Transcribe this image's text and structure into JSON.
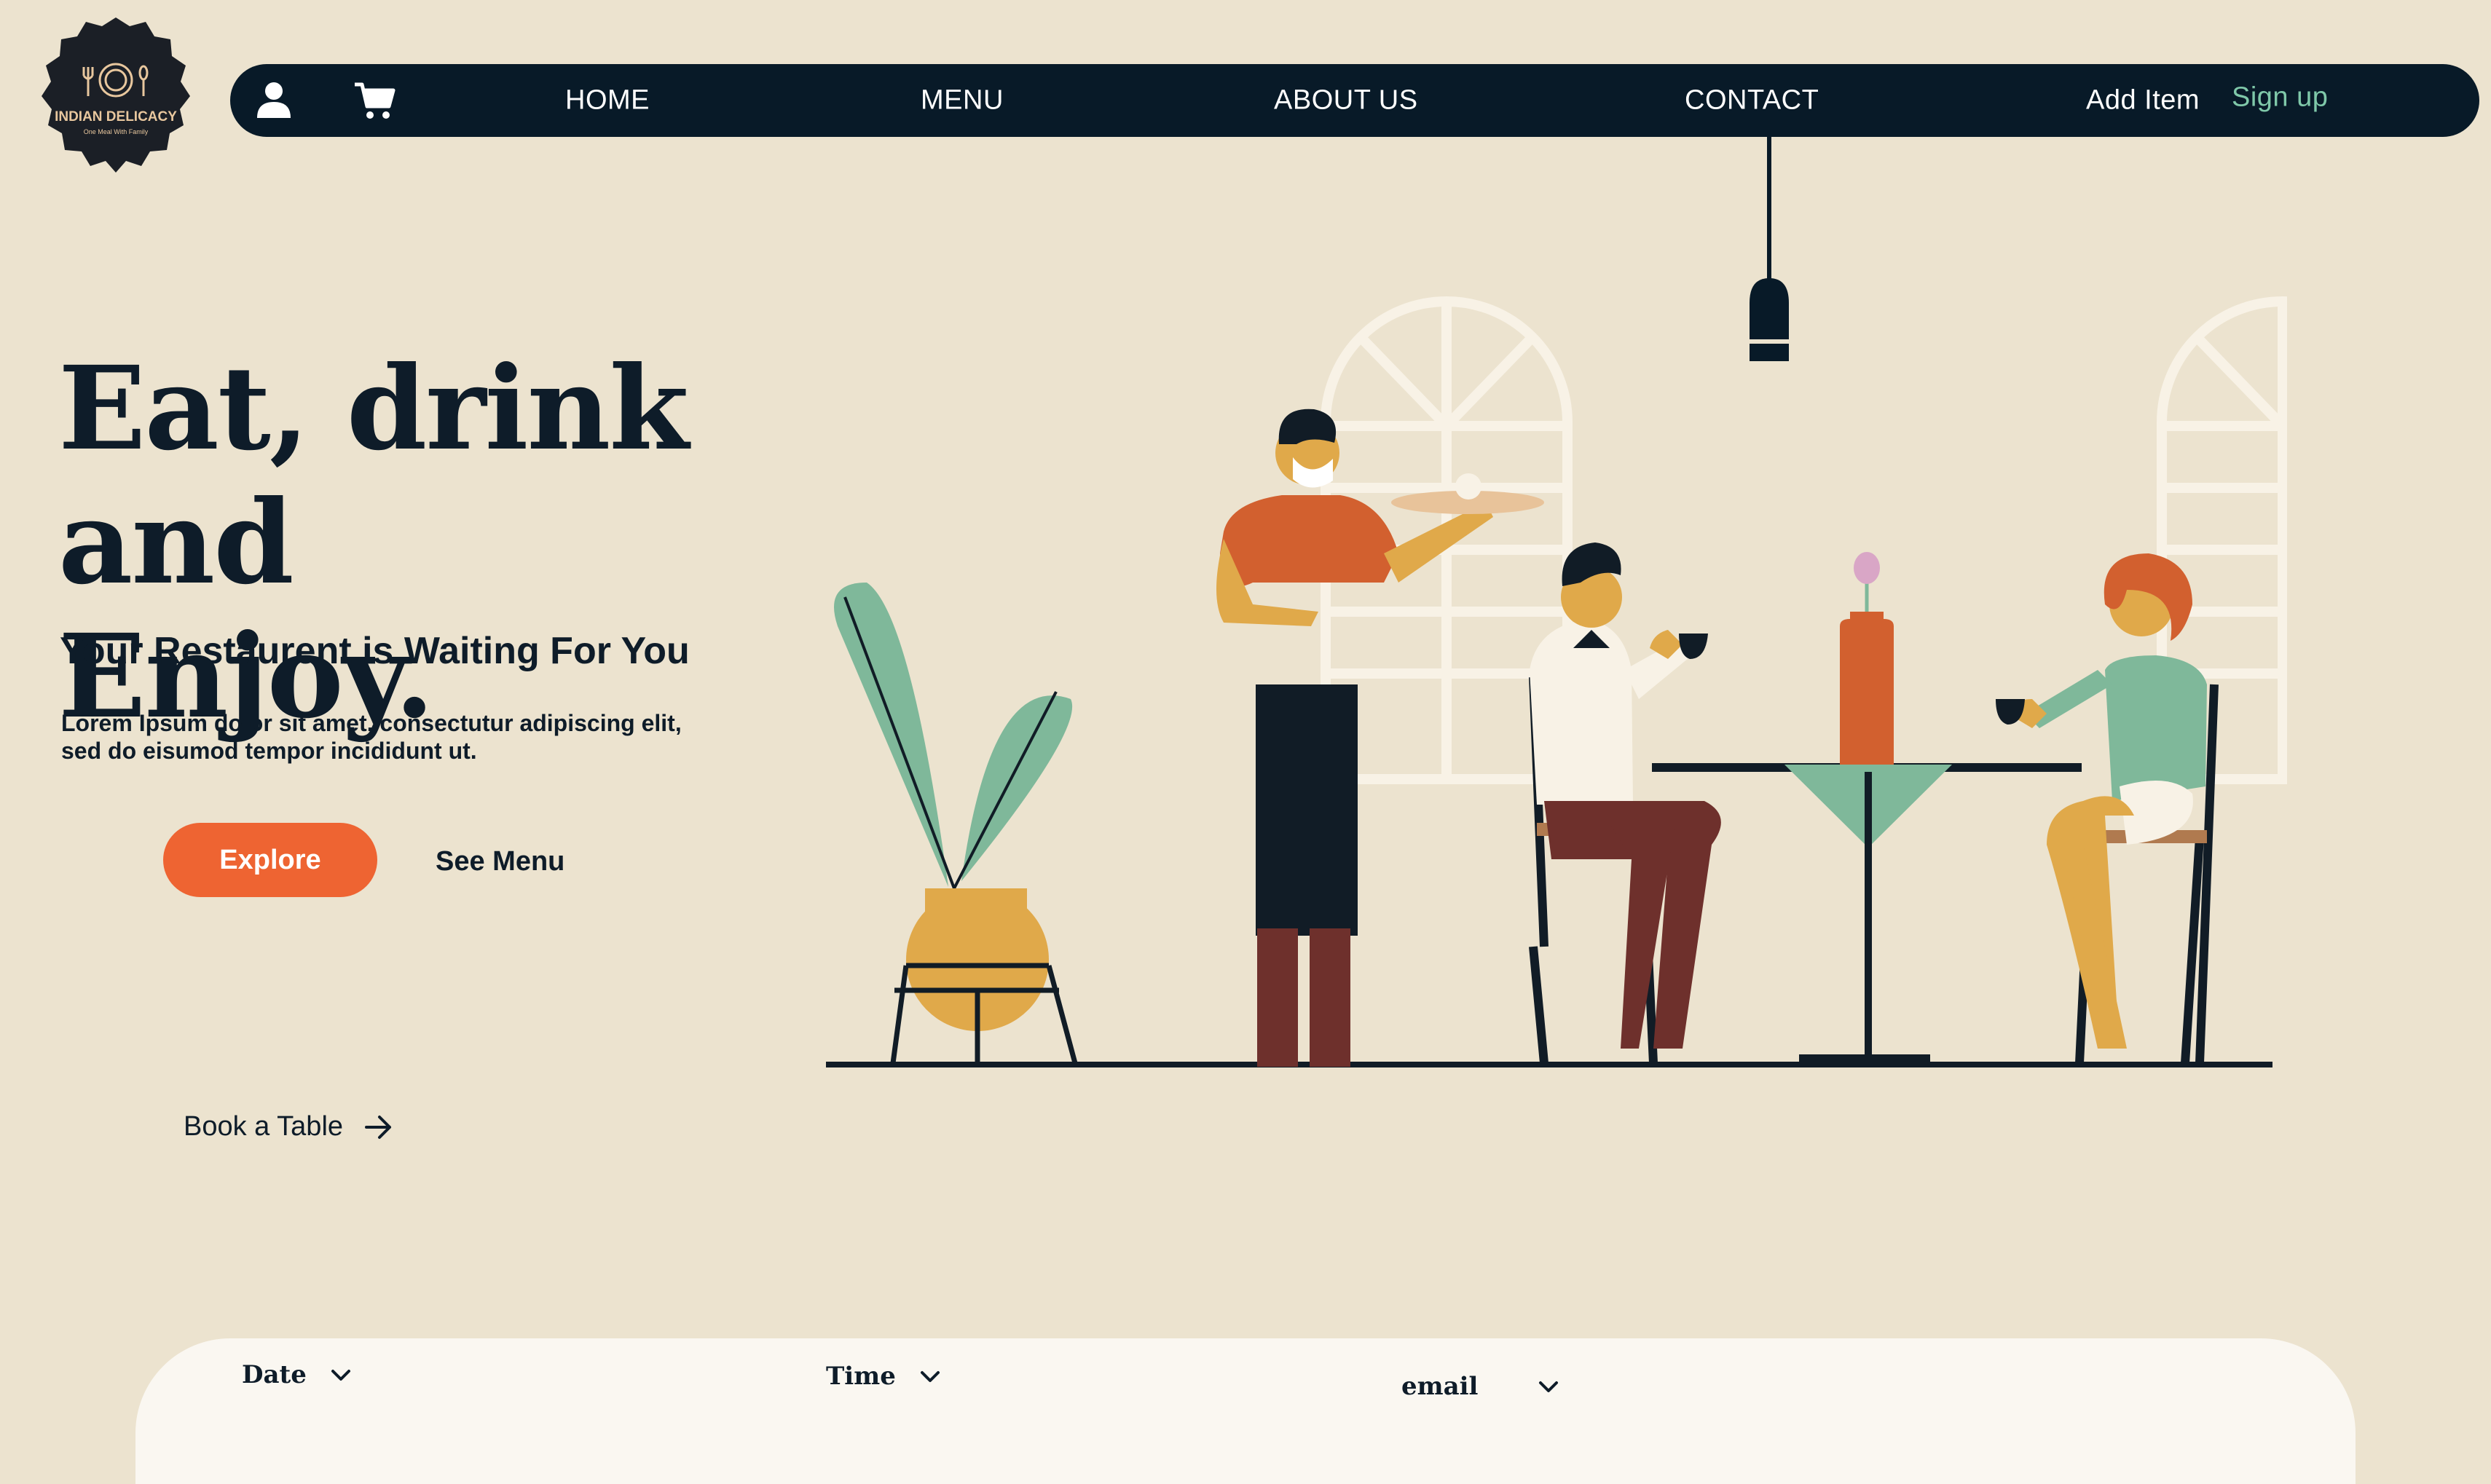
{
  "brand": {
    "name": "INDIAN DELICACY",
    "tagline": "One Meal With Family",
    "colors": {
      "logo_bg": "#1B1F26",
      "logo_text": "#E8C79E"
    }
  },
  "nav": {
    "icons": [
      "user-icon",
      "cart-icon"
    ],
    "links": [
      "HOME",
      "MENU",
      "ABOUT US",
      "CONTACT"
    ],
    "add_item": "Add Item",
    "sign_up": "Sign up",
    "colors": {
      "bar": "#081A28",
      "sign_up": "#7FC8A9"
    }
  },
  "hero": {
    "headline_line1": "Eat, drink and",
    "headline_line2": "Enjoy.",
    "subheading": "Your Restaurent is Waiting For You",
    "description": "Lorem Ipsum dolor sit amet, consectutur adipiscing elit, sed do eisumod tempor incididunt ut.",
    "explore_label": "Explore",
    "see_menu_label": "See Menu",
    "book_table_label": "Book a Table",
    "colors": {
      "accent": "#EE6432",
      "text": "#0E1C29",
      "background": "#ECE3CF"
    }
  },
  "booking": {
    "fields": [
      {
        "label": "Date",
        "icon": "chevron-down-icon"
      },
      {
        "label": "Time",
        "icon": "chevron-down-icon"
      },
      {
        "label": "email",
        "icon": "chevron-down-icon"
      }
    ],
    "colors": {
      "panel": "#FAF7F1"
    }
  },
  "illustration": {
    "subject": "restaurant-scene-illustration",
    "colors": {
      "orange": "#D2602F",
      "green": "#7FB89A",
      "mustard": "#E0A94A",
      "navy": "#111C26",
      "maroon": "#6E302C",
      "window": "#F8F2E6"
    }
  }
}
